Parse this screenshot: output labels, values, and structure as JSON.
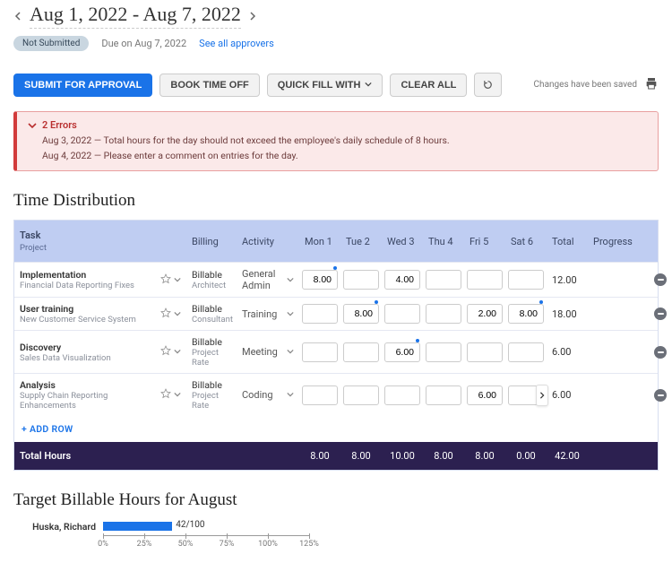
{
  "dateRange": "Aug 1, 2022 - Aug 7, 2022",
  "status": {
    "pill": "Not Submitted",
    "due": "Due on Aug 7, 2022",
    "approversLink": "See all approvers"
  },
  "toolbar": {
    "submit": "SUBMIT FOR APPROVAL",
    "bookOff": "BOOK TIME OFF",
    "quickFill": "QUICK FILL WITH",
    "clearAll": "CLEAR ALL",
    "saved": "Changes have been saved"
  },
  "errors": {
    "header": "2 Errors",
    "items": [
      "Aug 3, 2022 — Total hours for the day should not exceed the employee's daily schedule of 8 hours.",
      "Aug 4, 2022 — Please enter a comment on entries for the day."
    ]
  },
  "sections": {
    "timeDist": "Time Distribution",
    "targetHours": "Target Billable Hours for August"
  },
  "headers": {
    "task": "Task",
    "project": "Project",
    "billing": "Billing",
    "activity": "Activity",
    "days": [
      "Mon 1",
      "Tue 2",
      "Wed 3",
      "Thu 4",
      "Fri 5",
      "Sat 6"
    ],
    "total": "Total",
    "progress": "Progress"
  },
  "rows": [
    {
      "task": "Implementation",
      "project": "Financial Data Reporting Fixes",
      "billing": "Billable",
      "rate": "Architect",
      "activity": "General Admin",
      "cells": [
        {
          "v": "8.00",
          "d": true
        },
        {
          "v": ""
        },
        {
          "v": "4.00"
        },
        {
          "v": ""
        },
        {
          "v": ""
        },
        {
          "v": ""
        }
      ],
      "total": "12.00"
    },
    {
      "task": "User training",
      "project": "New Customer Service System",
      "billing": "Billable",
      "rate": "Consultant",
      "activity": "Training",
      "cells": [
        {
          "v": ""
        },
        {
          "v": "8.00",
          "d": true
        },
        {
          "v": ""
        },
        {
          "v": ""
        },
        {
          "v": "2.00"
        },
        {
          "v": "8.00",
          "d": true
        }
      ],
      "total": "18.00"
    },
    {
      "task": "Discovery",
      "project": "Sales Data Visualization",
      "billing": "Billable",
      "rate": "Project Rate",
      "activity": "Meeting",
      "cells": [
        {
          "v": ""
        },
        {
          "v": ""
        },
        {
          "v": "6.00",
          "d": true
        },
        {
          "v": ""
        },
        {
          "v": ""
        },
        {
          "v": ""
        }
      ],
      "total": "6.00"
    },
    {
      "task": "Analysis",
      "project": "Supply Chain Reporting Enhancements",
      "billing": "Billable",
      "rate": "Project Rate",
      "activity": "Coding",
      "cells": [
        {
          "v": ""
        },
        {
          "v": ""
        },
        {
          "v": ""
        },
        {
          "v": ""
        },
        {
          "v": "6.00"
        },
        {
          "v": ""
        }
      ],
      "total": "6.00"
    }
  ],
  "addRow": "+ ADD ROW",
  "totals": {
    "label": "Total Hours",
    "days": [
      "8.00",
      "8.00",
      "10.00",
      "8.00",
      "8.00",
      "0.00"
    ],
    "grand": "42.00"
  },
  "chart_data": {
    "type": "bar",
    "orientation": "horizontal",
    "title": "Target Billable Hours for August",
    "categories": [
      "Huska, Richard"
    ],
    "values": [
      42
    ],
    "max": 100,
    "value_label": "42/100",
    "xlabel": "",
    "ylabel": "",
    "xticks": [
      0,
      25,
      50,
      75,
      100,
      125
    ],
    "xticklabels": [
      "0%",
      "25%",
      "50%",
      "75%",
      "100%",
      "125%"
    ]
  }
}
